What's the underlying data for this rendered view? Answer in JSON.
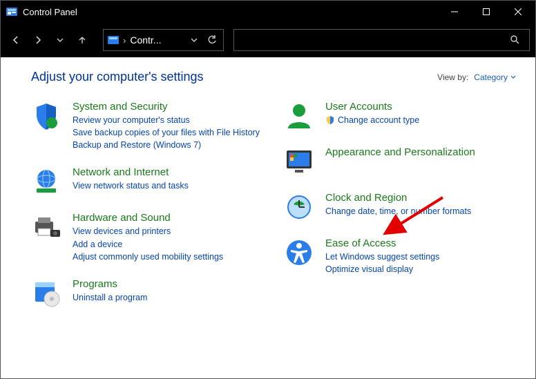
{
  "window": {
    "title": "Control Panel"
  },
  "breadcrumb": {
    "text": "Contr..."
  },
  "header": {
    "title": "Adjust your computer's settings",
    "view_by_label": "View by:",
    "view_by_value": "Category"
  },
  "left_col": [
    {
      "title": "System and Security",
      "links": [
        "Review your computer's status",
        "Save backup copies of your files with File History",
        "Backup and Restore (Windows 7)"
      ]
    },
    {
      "title": "Network and Internet",
      "links": [
        "View network status and tasks"
      ]
    },
    {
      "title": "Hardware and Sound",
      "links": [
        "View devices and printers",
        "Add a device",
        "Adjust commonly used mobility settings"
      ]
    },
    {
      "title": "Programs",
      "links": [
        "Uninstall a program"
      ]
    }
  ],
  "right_col": [
    {
      "title": "User Accounts",
      "links": [
        "Change account type"
      ],
      "shield": true
    },
    {
      "title": "Appearance and Personalization",
      "links": []
    },
    {
      "title": "Clock and Region",
      "links": [
        "Change date, time, or number formats"
      ]
    },
    {
      "title": "Ease of Access",
      "links": [
        "Let Windows suggest settings",
        "Optimize visual display"
      ]
    }
  ]
}
